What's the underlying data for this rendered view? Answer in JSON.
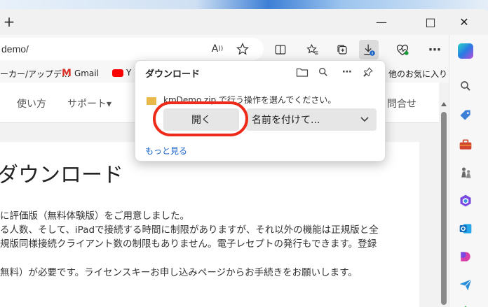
{
  "titlebar": {
    "newtab_glyph": "+",
    "minimize_glyph": "—",
    "maximize_glyph": "□",
    "close_glyph": "✕"
  },
  "toolbar": {
    "url": "demo/",
    "read_aloud_label": "A"
  },
  "bookmarks": {
    "items": [
      {
        "label": "ーカー/アップデ..."
      },
      {
        "label": "Gmail"
      },
      {
        "label": "Y"
      },
      {
        "label": "他のお気に入り"
      }
    ]
  },
  "page": {
    "nav": [
      "使い方",
      "サポート▾",
      "問合せ"
    ],
    "heading": "ダウンロード",
    "paragraphs": [
      "に評価版（無料体験版）をご用意しました。",
      "る人数、そして、iPadで接続する時間に制限がありますが、それ以外の機能は正規版と全",
      "規版同様接続クライアント数の制限もありません。電子レセプトの発行もできます。登録",
      "無料）が必要です。ライセンスキーお申し込みページからお手続きをお願いします。"
    ]
  },
  "download_flyout": {
    "title": "ダウンロード",
    "message": "kmDemo.zip で行う操作を選んでください。",
    "open_button": "開く",
    "save_as_button": "名前を付けて...",
    "see_more": "もっと見る"
  },
  "colors": {
    "accent": "#1a64c8",
    "highlight": "#ee2a1b",
    "file_icon": "#e8b94a"
  }
}
